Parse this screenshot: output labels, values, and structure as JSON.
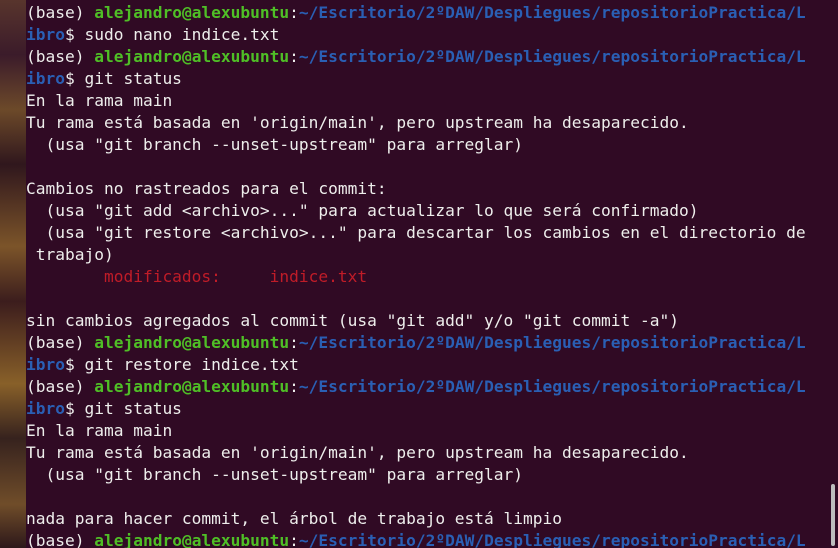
{
  "colors": {
    "background": "#300a24",
    "user_host": "#4fbf26",
    "path": "#2a5fb4",
    "modified": "#c01c28",
    "text": "#eeeeec"
  },
  "terminal": {
    "lines": [
      {
        "type": "prompt",
        "env": "(base) ",
        "user": "alejandro@alexubuntu",
        "sep": ":",
        "path": "~/Escritorio/2ºDAW/Despliegues/repositorioPractica/L"
      },
      {
        "type": "promptcont",
        "path_cont": "ibro",
        "cmd": "$ sudo nano indice.txt"
      },
      {
        "type": "prompt",
        "env": "(base) ",
        "user": "alejandro@alexubuntu",
        "sep": ":",
        "path": "~/Escritorio/2ºDAW/Despliegues/repositorioPractica/L"
      },
      {
        "type": "promptcont",
        "path_cont": "ibro",
        "cmd": "$ git status"
      },
      {
        "type": "text",
        "text": "En la rama main"
      },
      {
        "type": "text",
        "text": "Tu rama está basada en 'origin/main', pero upstream ha desaparecido."
      },
      {
        "type": "text",
        "text": "  (usa \"git branch --unset-upstream\" para arreglar)"
      },
      {
        "type": "text",
        "text": ""
      },
      {
        "type": "text",
        "text": "Cambios no rastreados para el commit:"
      },
      {
        "type": "text",
        "text": "  (usa \"git add <archivo>...\" para actualizar lo que será confirmado)"
      },
      {
        "type": "text",
        "text": "  (usa \"git restore <archivo>...\" para descartar los cambios en el directorio de"
      },
      {
        "type": "text",
        "text": " trabajo)"
      },
      {
        "type": "modified",
        "label": "        modificados:     ",
        "file": "indice.txt"
      },
      {
        "type": "text",
        "text": ""
      },
      {
        "type": "text",
        "text": "sin cambios agregados al commit (usa \"git add\" y/o \"git commit -a\")"
      },
      {
        "type": "prompt",
        "env": "(base) ",
        "user": "alejandro@alexubuntu",
        "sep": ":",
        "path": "~/Escritorio/2ºDAW/Despliegues/repositorioPractica/L"
      },
      {
        "type": "promptcont",
        "path_cont": "ibro",
        "cmd": "$ git restore indice.txt"
      },
      {
        "type": "prompt",
        "env": "(base) ",
        "user": "alejandro@alexubuntu",
        "sep": ":",
        "path": "~/Escritorio/2ºDAW/Despliegues/repositorioPractica/L"
      },
      {
        "type": "promptcont",
        "path_cont": "ibro",
        "cmd": "$ git status"
      },
      {
        "type": "text",
        "text": "En la rama main"
      },
      {
        "type": "text",
        "text": "Tu rama está basada en 'origin/main', pero upstream ha desaparecido."
      },
      {
        "type": "text",
        "text": "  (usa \"git branch --unset-upstream\" para arreglar)"
      },
      {
        "type": "text",
        "text": ""
      },
      {
        "type": "text",
        "text": "nada para hacer commit, el árbol de trabajo está limpio"
      },
      {
        "type": "prompt",
        "env": "(base) ",
        "user": "alejandro@alexubuntu",
        "sep": ":",
        "path": "~/Escritorio/2ºDAW/Despliegues/repositorioPractica/L"
      }
    ]
  }
}
